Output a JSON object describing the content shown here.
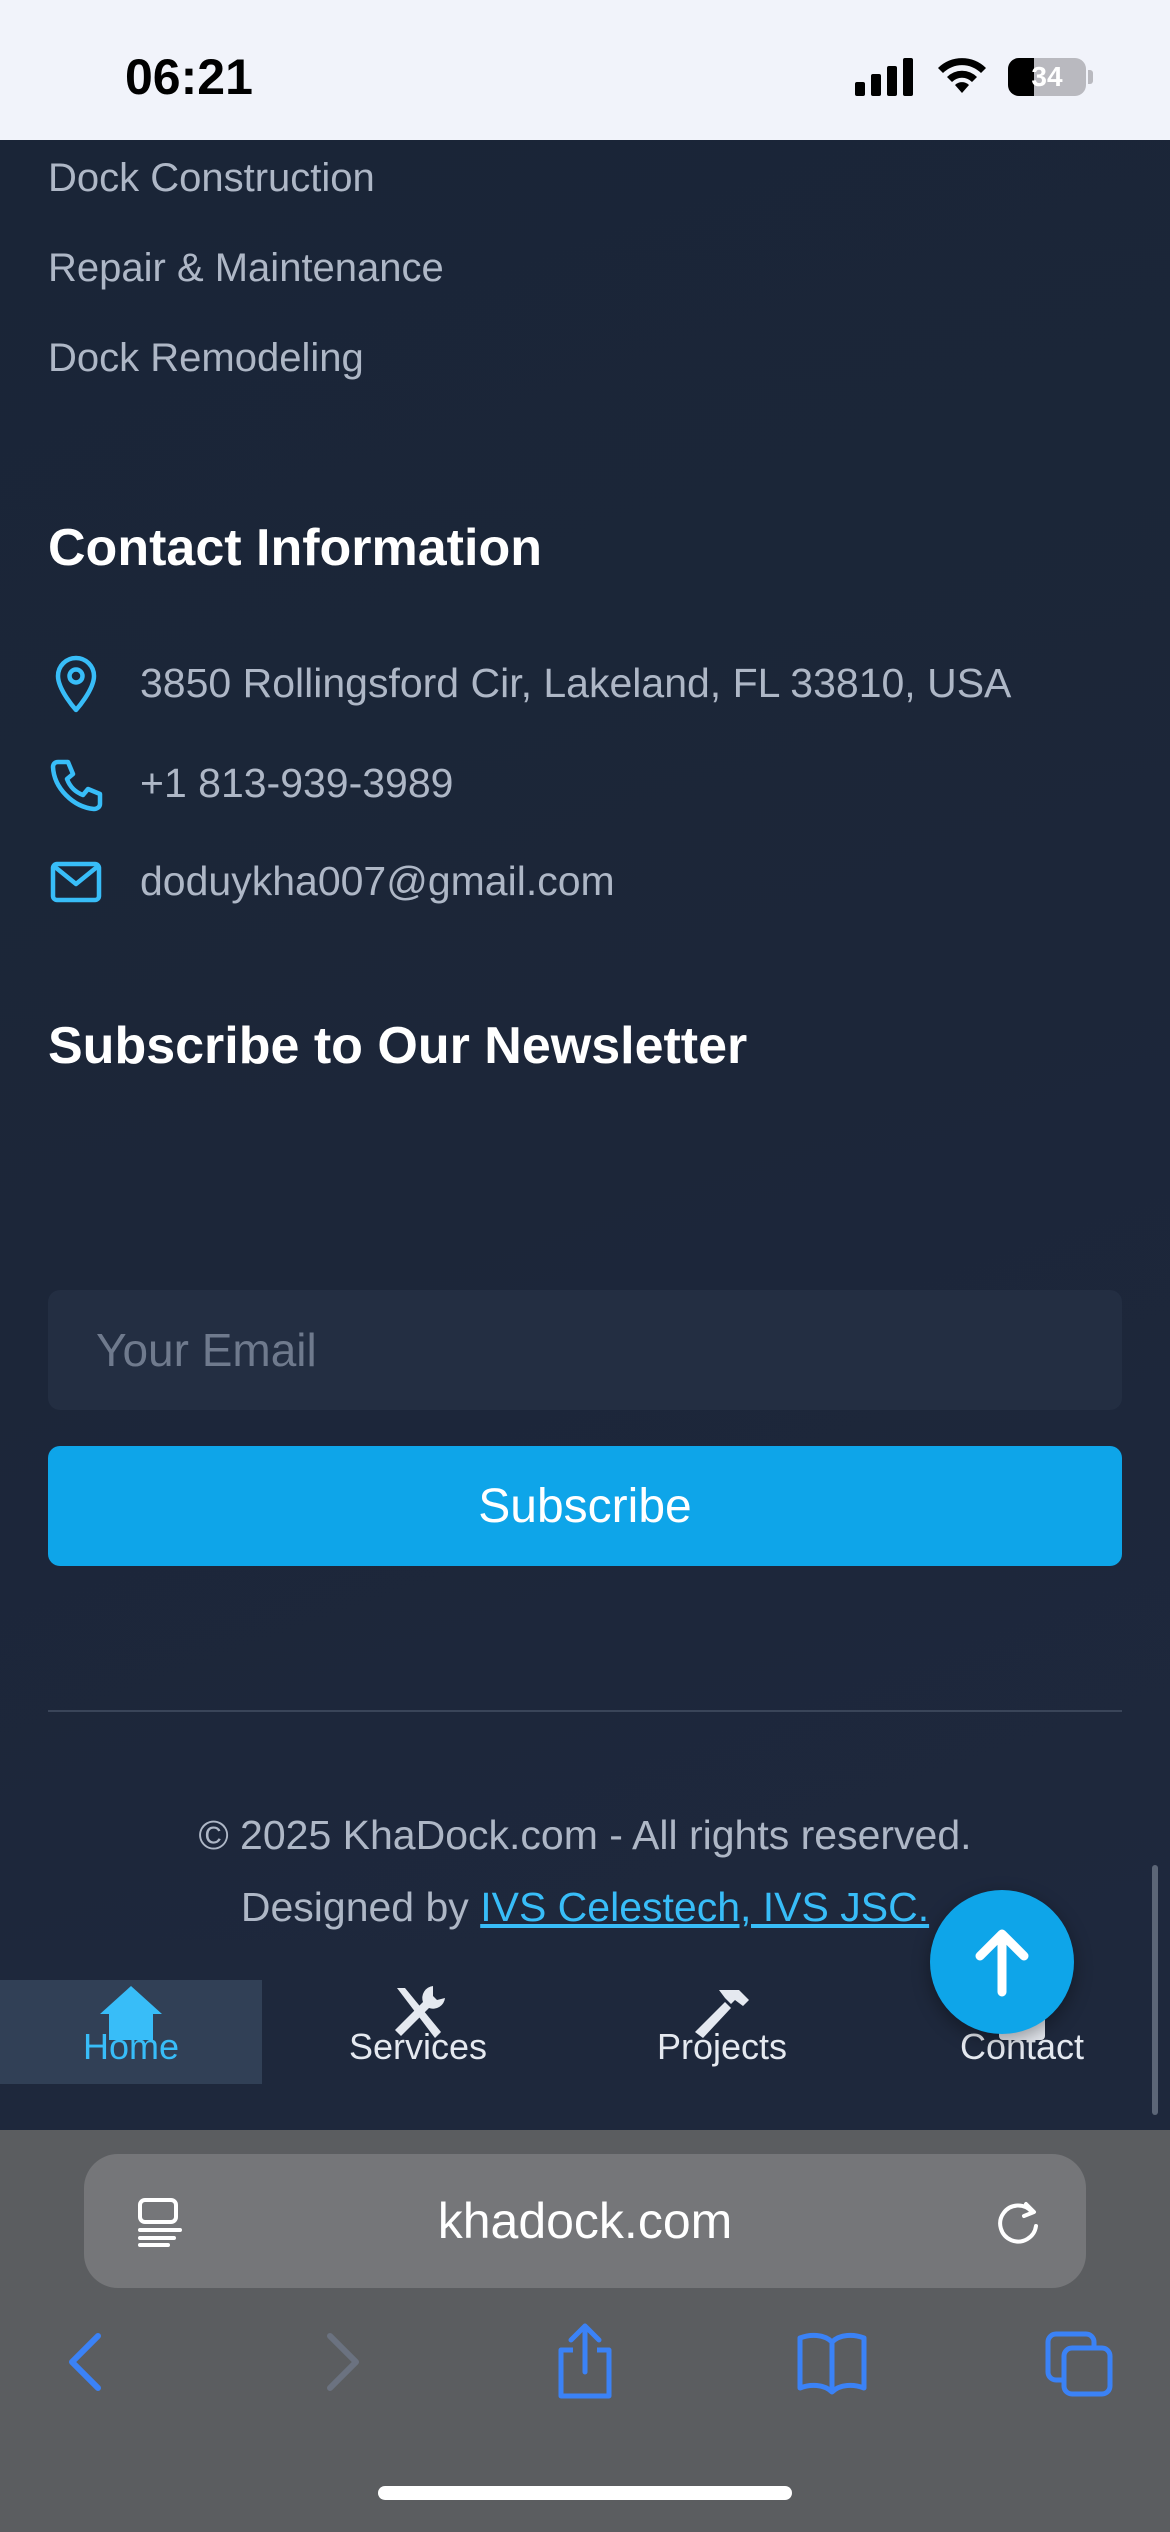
{
  "status_bar": {
    "time": "06:21",
    "battery": "34"
  },
  "footer": {
    "services": [
      "Dock Construction",
      "Repair & Maintenance",
      "Dock Remodeling"
    ],
    "contact": {
      "title": "Contact Information",
      "address": "3850 Rollingsford Cir, Lakeland, FL 33810, USA",
      "phone": "+1 813-939-3989",
      "email": "doduykha007@gmail.com"
    },
    "newsletter": {
      "title": "Subscribe to Our Newsletter",
      "placeholder": "Your Email",
      "button": "Subscribe"
    },
    "copyright": "© 2025 KhaDock.com - All rights reserved.",
    "designed_prefix": "Designed by ",
    "designed_link": "IVS Celestech, IVS JSC."
  },
  "bottom_nav": {
    "items": [
      {
        "label": "Home",
        "icon": "home-icon",
        "active": true
      },
      {
        "label": "Services",
        "icon": "tools-icon",
        "active": false
      },
      {
        "label": "Projects",
        "icon": "hammer-icon",
        "active": false
      },
      {
        "label": "Contact",
        "icon": "contact-icon",
        "active": false
      }
    ]
  },
  "safari": {
    "url": "khadock.com"
  },
  "colors": {
    "accent": "#0ea5e9",
    "link": "#38bdf8",
    "background": "#1b2438"
  }
}
